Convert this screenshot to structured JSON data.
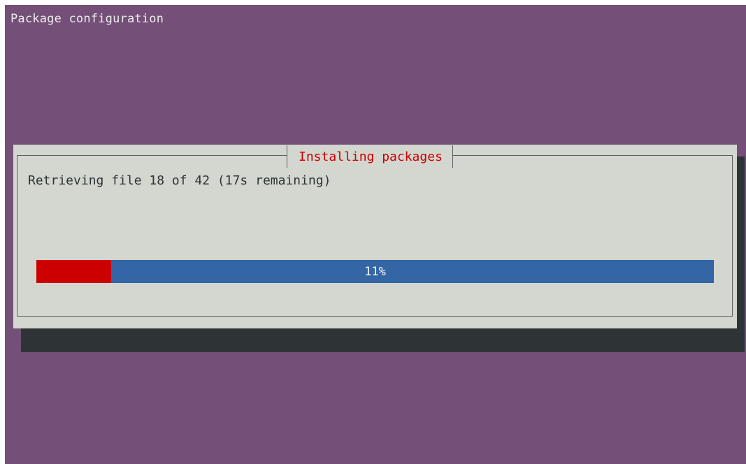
{
  "window": {
    "backtitle": "Package configuration",
    "background_color": "#744f78"
  },
  "dialog": {
    "title": "Installing packages",
    "status": "Retrieving file 18 of 42 (17s remaining)",
    "title_color": "#cc0000",
    "background_color": "#d3d7cf"
  },
  "progress": {
    "percent": 11,
    "label": "11%",
    "fill_color": "#cc0000",
    "track_color": "#3465a4"
  }
}
